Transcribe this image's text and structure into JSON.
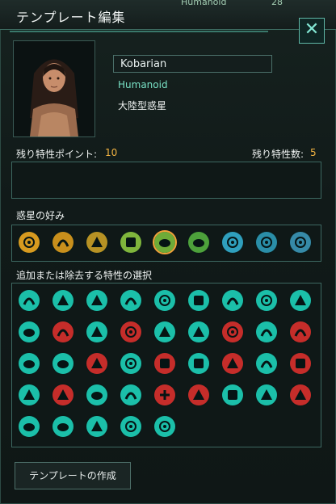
{
  "window": {
    "title": "テンプレート編集",
    "top_overlay_text": "Humanoid",
    "top_overlay_value": "28",
    "close_label": "✕"
  },
  "species": {
    "name": "Kobarian",
    "class": "Humanoid",
    "planet_type": "大陸型惑星"
  },
  "traits": {
    "points_label": "残り特性ポイント:",
    "points_value": "10",
    "count_label": "残り特性数:",
    "count_value": "5"
  },
  "preferences": {
    "label": "惑星の好み",
    "items": [
      {
        "name": "desert-planet-icon",
        "color": "#d79a1f"
      },
      {
        "name": "arid-planet-icon",
        "color": "#c88f1c"
      },
      {
        "name": "savanna-planet-icon",
        "color": "#b79224"
      },
      {
        "name": "tropical-planet-icon",
        "color": "#7fb53c"
      },
      {
        "name": "continental-planet-icon",
        "color": "#6eab38",
        "selected": true
      },
      {
        "name": "ocean-planet-icon",
        "color": "#4da13b"
      },
      {
        "name": "arctic-planet-icon",
        "color": "#2f9fbd"
      },
      {
        "name": "tundra-planet-icon",
        "color": "#2a8ea8"
      },
      {
        "name": "alpine-planet-icon",
        "color": "#368aa8"
      }
    ]
  },
  "trait_selection": {
    "label": "追加または除去する特性の選択",
    "rows": [
      [
        {
          "name": "industrious-trait-icon",
          "color": "#1bbfa9"
        },
        {
          "name": "communal-trait-icon",
          "color": "#1bbfa9"
        },
        {
          "name": "agrarian-trait-icon",
          "color": "#1bbfa9"
        },
        {
          "name": "intelligent-trait-icon",
          "color": "#1bbfa9"
        },
        {
          "name": "thrifty-trait-icon",
          "color": "#1bbfa9"
        },
        {
          "name": "ingenious-trait-icon",
          "color": "#1bbfa9"
        },
        {
          "name": "natural-physicist-trait-icon",
          "color": "#1bbfa9"
        },
        {
          "name": "natural-sociologist-trait-icon",
          "color": "#1bbfa9"
        },
        {
          "name": "adaptive-trait-icon",
          "color": "#1bbfa9"
        }
      ],
      [
        {
          "name": "extremely-adaptive-trait-icon",
          "color": "#1bbfa9"
        },
        {
          "name": "nonadaptive-trait-icon",
          "color": "#c52d2a"
        },
        {
          "name": "rapid-breeders-trait-icon",
          "color": "#1bbfa9"
        },
        {
          "name": "slow-breeders-trait-icon",
          "color": "#c52d2a"
        },
        {
          "name": "talented-trait-icon",
          "color": "#1bbfa9"
        },
        {
          "name": "quick-learners-trait-icon",
          "color": "#1bbfa9"
        },
        {
          "name": "slow-learners-trait-icon",
          "color": "#c52d2a"
        },
        {
          "name": "traditional-trait-icon",
          "color": "#1bbfa9"
        },
        {
          "name": "quarrelsome-trait-icon",
          "color": "#c52d2a"
        }
      ],
      [
        {
          "name": "docile-trait-icon",
          "color": "#1bbfa9"
        },
        {
          "name": "unruly-trait-icon",
          "color": "#1bbfa9"
        },
        {
          "name": "deviants-trait-icon",
          "color": "#c52d2a"
        },
        {
          "name": "nomadic-trait-icon",
          "color": "#1bbfa9"
        },
        {
          "name": "sedentary-trait-icon",
          "color": "#c52d2a"
        },
        {
          "name": "social-cohesion-trait-icon",
          "color": "#1bbfa9"
        },
        {
          "name": "solitary-trait-icon",
          "color": "#c52d2a"
        },
        {
          "name": "charismatic-trait-icon",
          "color": "#1bbfa9"
        },
        {
          "name": "repugnant-trait-icon",
          "color": "#c52d2a"
        }
      ],
      [
        {
          "name": "enduring-trait-icon",
          "color": "#1bbfa9"
        },
        {
          "name": "fleeting-trait-icon",
          "color": "#c52d2a"
        },
        {
          "name": "strong-trait-icon",
          "color": "#1bbfa9"
        },
        {
          "name": "very-strong-trait-icon",
          "color": "#1bbfa9"
        },
        {
          "name": "weak-trait-icon",
          "color": "#c52d2a"
        },
        {
          "name": "decadent-trait-icon",
          "color": "#c52d2a"
        },
        {
          "name": "resilient-trait-icon",
          "color": "#1bbfa9"
        },
        {
          "name": "conservational-trait-icon",
          "color": "#1bbfa9"
        },
        {
          "name": "wasteful-trait-icon",
          "color": "#c52d2a"
        }
      ],
      [
        {
          "name": "phototrophic-trait-icon",
          "color": "#1bbfa9"
        },
        {
          "name": "empath-trait-icon",
          "color": "#1bbfa9"
        },
        {
          "name": "prolific-trait-icon",
          "color": "#1bbfa9"
        },
        {
          "name": "masonry-trait-icon",
          "color": "#1bbfa9"
        },
        {
          "name": "budding-trait-icon",
          "color": "#1bbfa9"
        }
      ]
    ]
  },
  "create_button_label": "テンプレートの作成"
}
